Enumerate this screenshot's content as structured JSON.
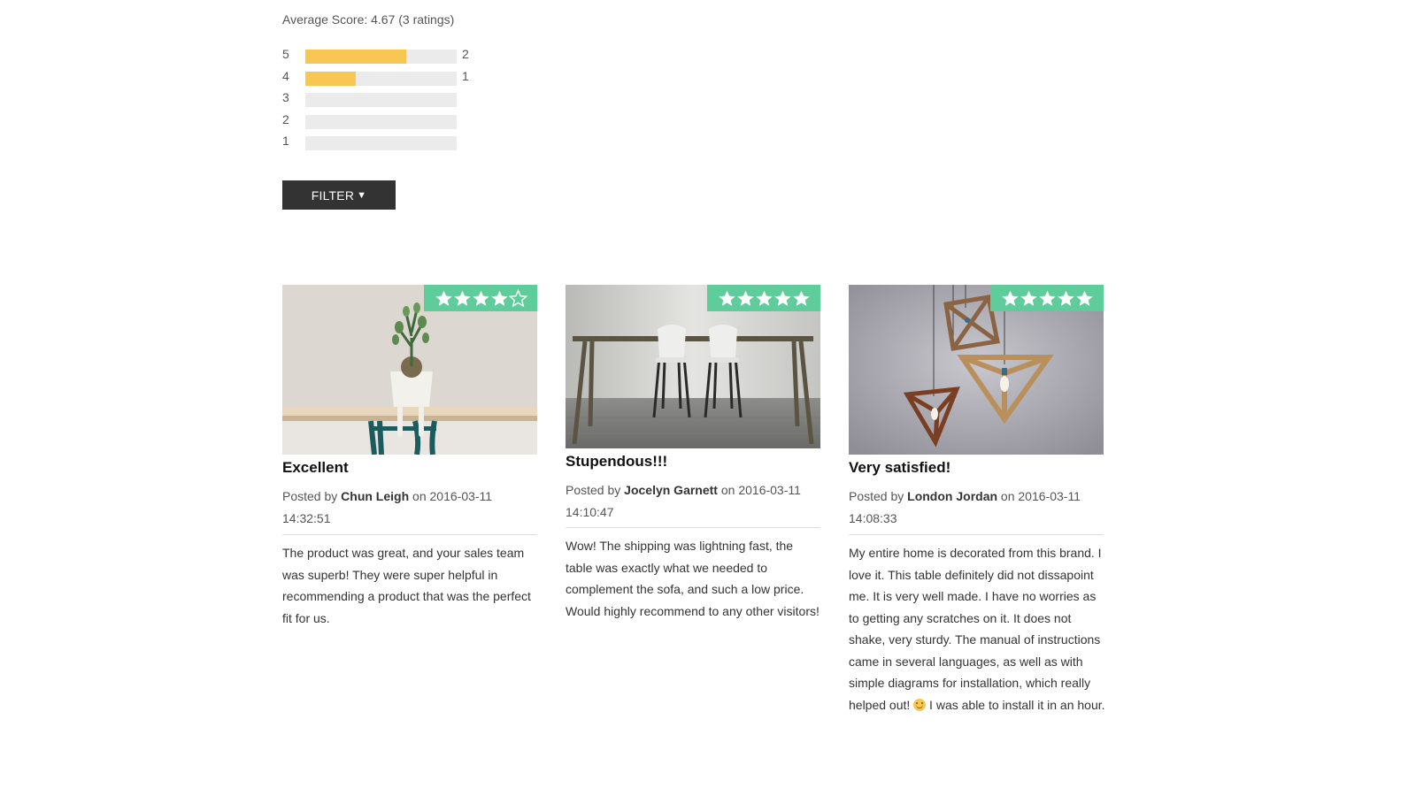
{
  "summary": {
    "average_label": "Average Score: 4.67 (3 ratings)",
    "histogram": [
      {
        "stars": "5",
        "count": "2",
        "fill": 0.667
      },
      {
        "stars": "4",
        "count": "1",
        "fill": 0.333
      },
      {
        "stars": "3",
        "count": "",
        "fill": 0
      },
      {
        "stars": "2",
        "count": "",
        "fill": 0
      },
      {
        "stars": "1",
        "count": "",
        "fill": 0
      }
    ]
  },
  "filter": {
    "label": "FILTER",
    "caret": "▼"
  },
  "reviews": [
    {
      "title": "Excellent",
      "rating": 4,
      "posted_prefix": "Posted by ",
      "author": "Chun Leigh",
      "posted_mid": " on 2016-03-11 14:32:51",
      "body": "The product was great, and your sales team was superb! They were super helpful in recommending a product that was the perfect fit for us.",
      "image": "plant-on-bench"
    },
    {
      "title": "Stupendous!!!",
      "rating": 5,
      "posted_prefix": "Posted by ",
      "author": "Jocelyn Garnett",
      "posted_mid": " on 2016-03-11 14:10:47",
      "body": "Wow! The shipping was lightning fast, the table was exactly what we needed to complement the sofa, and such a low price. Would highly recommend to any other visitors!",
      "image": "table-and-chairs"
    },
    {
      "title": "Very satisfied!",
      "rating": 5,
      "posted_prefix": "Posted by ",
      "author": "London Jordan",
      "posted_mid": " on 2016-03-11 14:08:33",
      "body_before": "My entire home is decorated from this brand. I love it. This table definitely did not dissapoint me. It is very well made. I have no worries as to getting any scratches on it. It does not shake, very sturdy. The manual of instructions came in several languages, as well as with simple diagrams for installation, which really helped out! ",
      "body_after": " I was able to install it in an hour.",
      "image": "geometric-pendant-lamps"
    }
  ],
  "colors": {
    "bar_fill": "#f8c652",
    "bar_track": "#ebebeb",
    "badge": "#5fcc9c",
    "button": "#333333"
  }
}
